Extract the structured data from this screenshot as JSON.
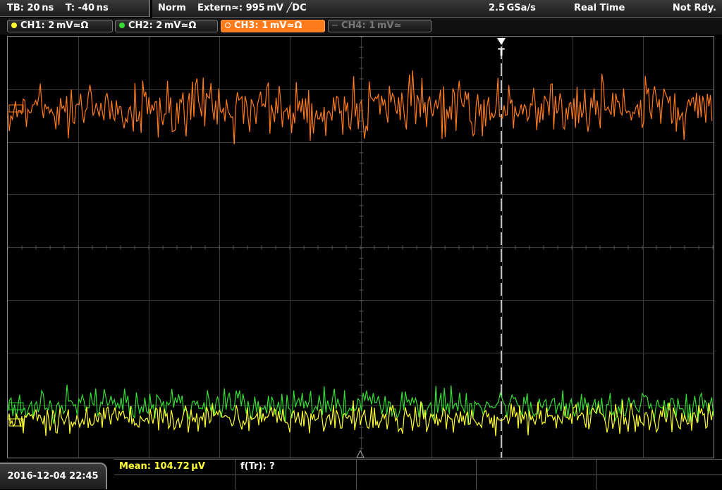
{
  "status": {
    "timebase": "TB: 20 ns",
    "trigger_time": "T: -40 ns",
    "trigger_mode": "Norm",
    "trigger_source": "Extern≃: 995 mV ╱DC",
    "sample_rate": "2.5 GSa/s",
    "acq_mode": "Real Time",
    "state": "Not Rdy."
  },
  "channels": [
    {
      "label": "CH1: 2 mV≃Ω",
      "color": "#ffff33",
      "active": false,
      "enabled": true
    },
    {
      "label": "CH2: 2 mV≃Ω",
      "color": "#33dd33",
      "active": false,
      "enabled": true
    },
    {
      "label": "CH3: 1 mV≃Ω",
      "color": "#ff7a1a",
      "active": true,
      "enabled": true
    },
    {
      "label": "CH4: 1 mV≃",
      "color": "#777777",
      "active": false,
      "enabled": false
    }
  ],
  "markers": {
    "trigger": "T"
  },
  "bottom": {
    "datetime": "2016-12-04 22:45",
    "measurement_1": "Mean: 104.72 µV",
    "measurement_2": "f(Tr): ?"
  },
  "colors": {
    "ch1": "#ffff33",
    "ch2": "#33dd33",
    "ch3": "#ff7a1a"
  }
}
